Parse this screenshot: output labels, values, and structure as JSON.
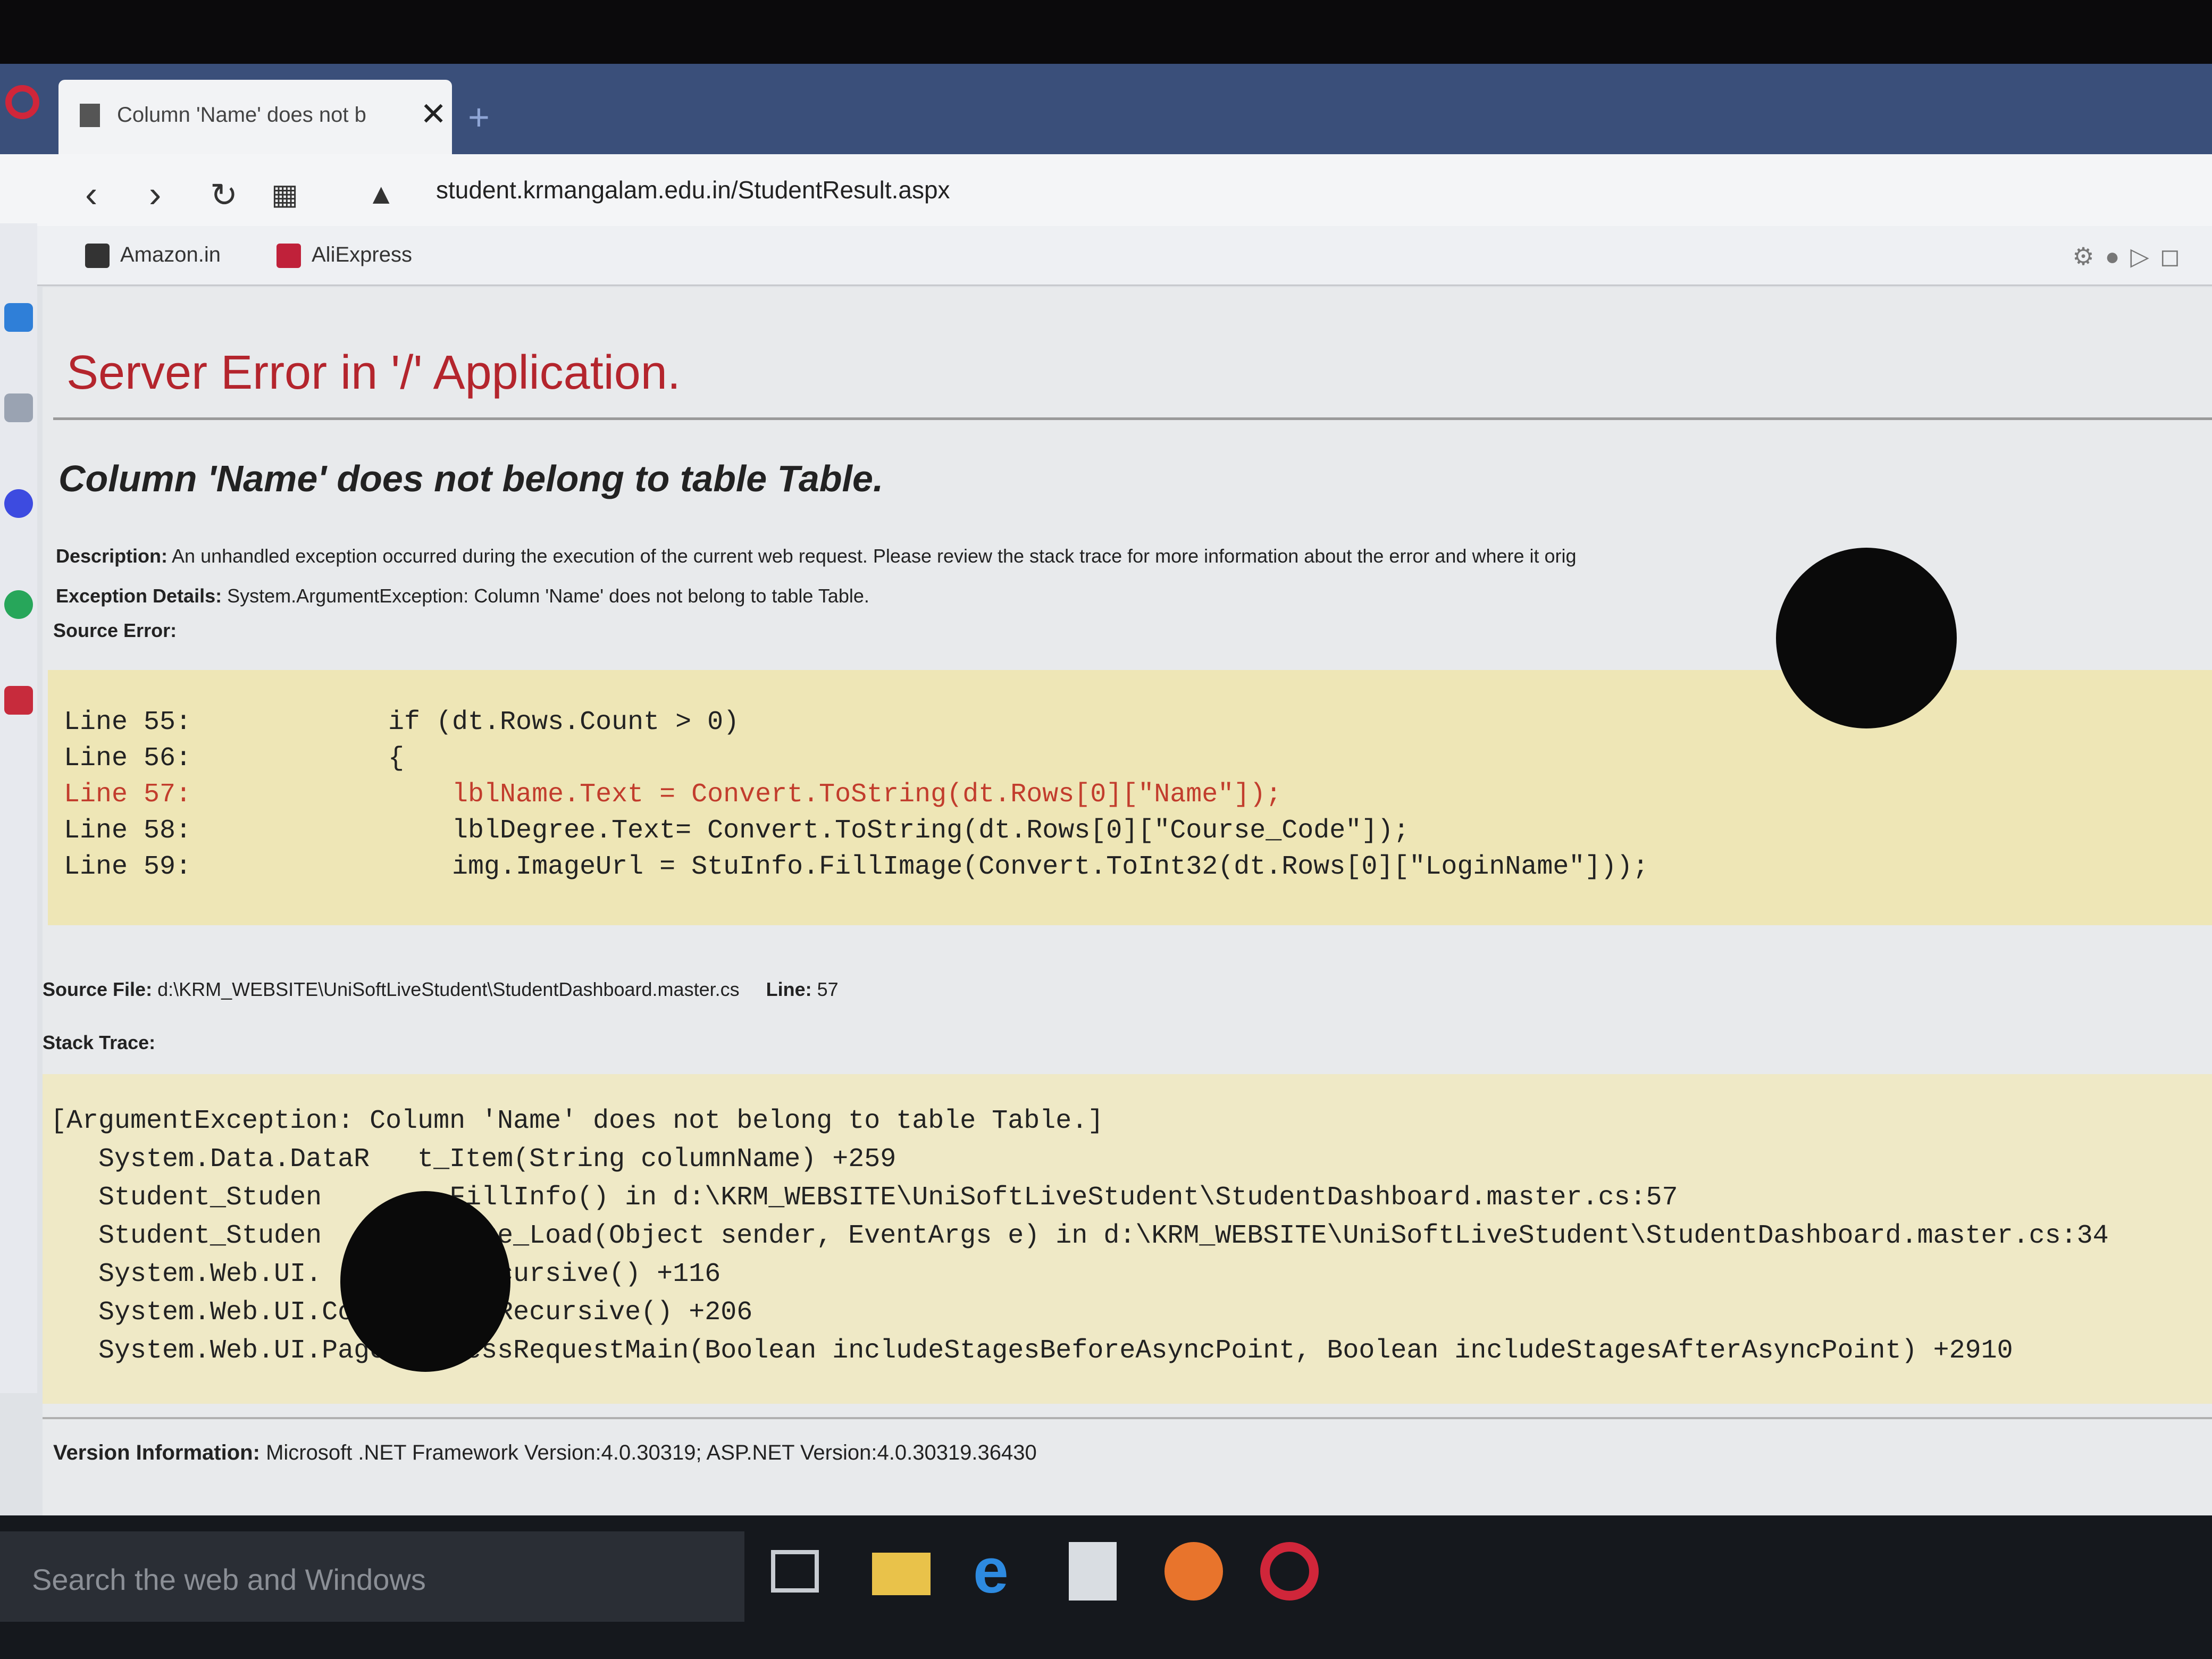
{
  "browser": {
    "tab_title": "Column 'Name' does not b",
    "tab_close": "✕",
    "new_tab": "+",
    "address": "student.krmangalam.edu.in/StudentResult.aspx",
    "bookmarks": [
      "Amazon.in",
      "AliExpress"
    ]
  },
  "page": {
    "heading": "Server Error in '/' Application.",
    "error_title": "Column 'Name' does not belong to table Table.",
    "description_label": "Description:",
    "description_text": "An unhandled exception occurred during the execution of the current web request. Please review the stack trace for more information about the error and where it orig",
    "exception_label": "Exception Details:",
    "exception_text": "System.ArgumentException: Column 'Name' does not belong to table Table.",
    "source_error_label": "Source Error:",
    "source_lines": [
      {
        "line": "Line 55:",
        "code": "    if (dt.Rows.Count > 0)"
      },
      {
        "line": "Line 56:",
        "code": "    {"
      },
      {
        "line": "Line 57:",
        "code": "        lblName.Text = Convert.ToString(dt.Rows[0][\"Name\"]);"
      },
      {
        "line": "Line 58:",
        "code": "        lblDegree.Text= Convert.ToString(dt.Rows[0][\"Course_Code\"]);"
      },
      {
        "line": "Line 59:",
        "code": "        img.ImageUrl = StuInfo.FillImage(Convert.ToInt32(dt.Rows[0][\"LoginName\"]));"
      }
    ],
    "source_file_label": "Source File:",
    "source_file": "d:\\KRM_WEBSITE\\UniSoftLiveStudent\\StudentDashboard.master.cs",
    "line_label": "Line:",
    "line_value": "57",
    "stack_trace_label": "Stack Trace:",
    "stack_trace": [
      "[ArgumentException: Column 'Name' does not belong to table Table.]",
      "   System.Data.DataR   t_Item(String columnName) +259",
      "   Student_Studen       .FillInfo() in d:\\KRM_WEBSITE\\UniSoftLiveStudent\\StudentDashboard.master.cs:57",
      "   Student_Studen       .Page_Load(Object sender, EventArgs e) in d:\\KRM_WEBSITE\\UniSoftLiveStudent\\StudentDashboard.master.cs:34",
      "   System.Web.UI.       adRecursive() +116",
      "   System.Web.UI.Co     LoadRecursive() +206",
      "   System.Web.UI.Page.ProcessRequestMain(Boolean includeStagesBeforeAsyncPoint, Boolean includeStagesAfterAsyncPoint) +2910"
    ],
    "version_label": "Version Information:",
    "version_text": "Microsoft .NET Framework Version:4.0.30319; ASP.NET Version:4.0.30319.36430"
  },
  "taskbar": {
    "search_placeholder": "Search the web and Windows"
  },
  "colors": {
    "error_heading": "#b4252d",
    "source_bg": "#eee6b6",
    "highlight_line": "#c23d2d"
  }
}
